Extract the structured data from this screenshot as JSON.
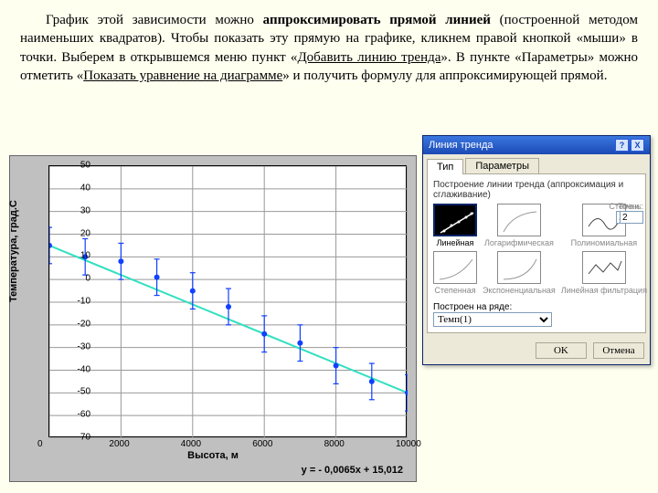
{
  "paragraph": {
    "t1": "График этой зависимости можно ",
    "b1": "аппроксимировать прямой линией",
    "t2": " (построенной методом наименьших квадратов). Чтобы показать эту прямую на графике, кликнем правой кнопкой «мыши» в точки. Выберем в открывшемся меню пункт «",
    "u1": "Добавить линию тренда",
    "t3": "». В пункте «Параметры» можно отметить «",
    "u2": "Показать уравнение на диаграмме",
    "t4": "» и получить формулу для аппроксимирующей прямой."
  },
  "chart_data": {
    "type": "scatter",
    "xlabel": "Высота, м",
    "ylabel": "Температура, град.С",
    "xlim": [
      0,
      10000
    ],
    "ylim": [
      -70,
      50
    ],
    "x_ticks": [
      0,
      2000,
      4000,
      6000,
      8000,
      10000
    ],
    "y_ticks": [
      -70,
      -60,
      -50,
      -40,
      -30,
      -20,
      -10,
      0,
      10,
      20,
      30,
      40,
      50
    ],
    "x": [
      0,
      1000,
      2000,
      3000,
      4000,
      5000,
      6000,
      7000,
      8000,
      9000,
      10000
    ],
    "y": [
      15,
      10,
      8,
      1,
      -5,
      -12,
      -24,
      -28,
      -38,
      -45,
      -50
    ],
    "y_err": 8,
    "trendline": {
      "slope": -0.0065,
      "intercept": 15.012
    },
    "equation": "y = - 0,0065x + 15,012"
  },
  "dialog": {
    "title": "Линия тренда",
    "help": "?",
    "close": "X",
    "tabs": {
      "type": "Тип",
      "params": "Параметры"
    },
    "group": "Построение линии тренда (аппроксимация и сглаживание)",
    "types": {
      "linear": "Линейная",
      "log": "Логарифмическая",
      "poly": "Полиномиальная",
      "power": "Степенная",
      "exp": "Экспоненциальная",
      "filter": "Линейная фильтрация"
    },
    "degree_label": "Степень:",
    "degree_value": "2",
    "points_label": "Точки:",
    "points_value": "2",
    "series_label": "Построен на ряде:",
    "series_value": "Темп(1)",
    "ok": "OK",
    "cancel": "Отмена"
  }
}
